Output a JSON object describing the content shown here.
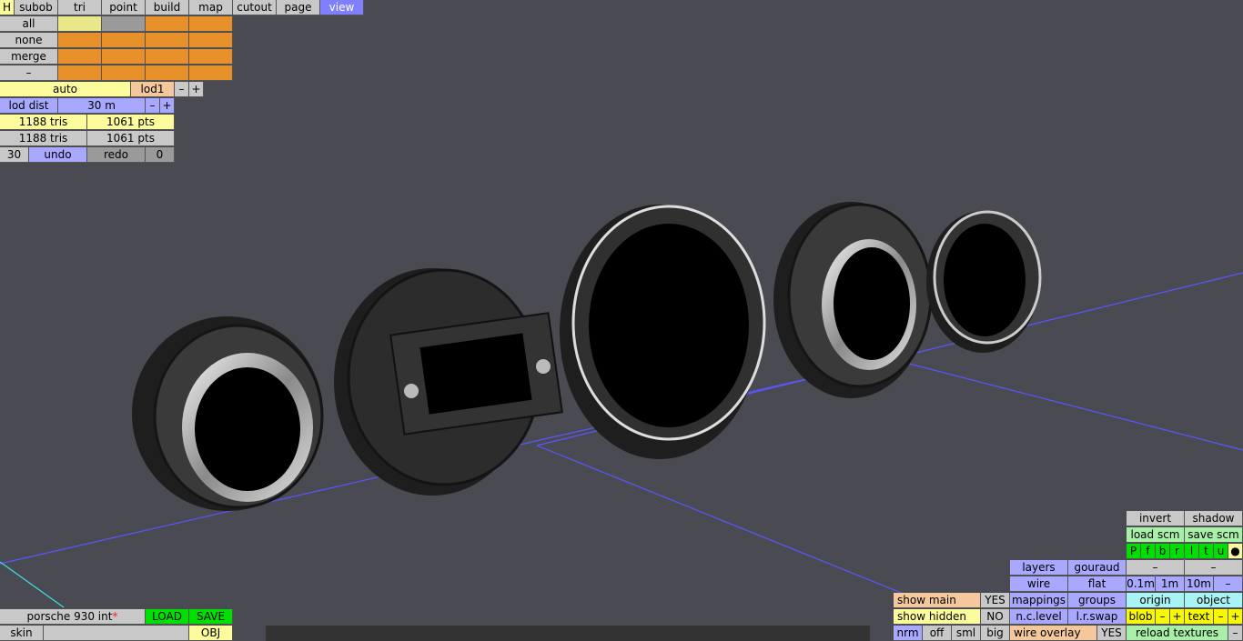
{
  "top_tabs": [
    "H",
    "subob",
    "tri",
    "point",
    "build",
    "map",
    "cutout",
    "page",
    "view"
  ],
  "sub_select": [
    "all",
    "none",
    "merge",
    "–"
  ],
  "lod": {
    "auto": "auto",
    "lod": "lod1",
    "minus": "–",
    "plus": "+",
    "dist_label": "lod dist",
    "dist_value": "30 m"
  },
  "stats": {
    "tris1": "1188 tris",
    "pts1": "1061 pts",
    "tris2": "1188 tris",
    "pts2": "1061 pts"
  },
  "undo": {
    "count": "30",
    "undo": "undo",
    "redo": "redo",
    "redo_count": "0"
  },
  "file": {
    "name": "porsche 930 int",
    "modified_mark": "*",
    "load": "LOAD",
    "save": "SAVE",
    "skin": "skin",
    "skin_value": "",
    "obj": "OBJ"
  },
  "right_panel": {
    "invert": "invert",
    "shadow": "shadow",
    "load_scm": "load scm",
    "save_scm": "save scm",
    "flags": [
      "P",
      "f",
      "b",
      "r",
      "l",
      "t",
      "u",
      "●"
    ],
    "dash1": "–",
    "dash2": "–",
    "layers": "layers",
    "gouraud": "gouraud",
    "wire": "wire",
    "flat": "flat",
    "d01": "0.1m",
    "d1": "1m",
    "d10": "10m",
    "dminus": "–",
    "show_main": "show main",
    "show_main_val": "YES",
    "mappings": "mappings",
    "groups": "groups",
    "origin": "origin",
    "object": "object",
    "show_hidden": "show hidden",
    "show_hidden_val": "NO",
    "nc_level": "n.c.level",
    "lr_swap": "l.r.swap",
    "blob": "blob",
    "blob_minus": "–",
    "blob_plus": "+",
    "text": "text",
    "text_minus": "–",
    "text_plus": "+",
    "nrm": "nrm",
    "off": "off",
    "sml": "sml",
    "big": "big",
    "wire_overlay": "wire overlay",
    "wire_overlay_val": "YES",
    "reload": "reload textures",
    "reload_minus": "–"
  },
  "colors": {
    "background": "#4a4a52",
    "grid": "#5858ff",
    "axis": "#40e0e0"
  }
}
